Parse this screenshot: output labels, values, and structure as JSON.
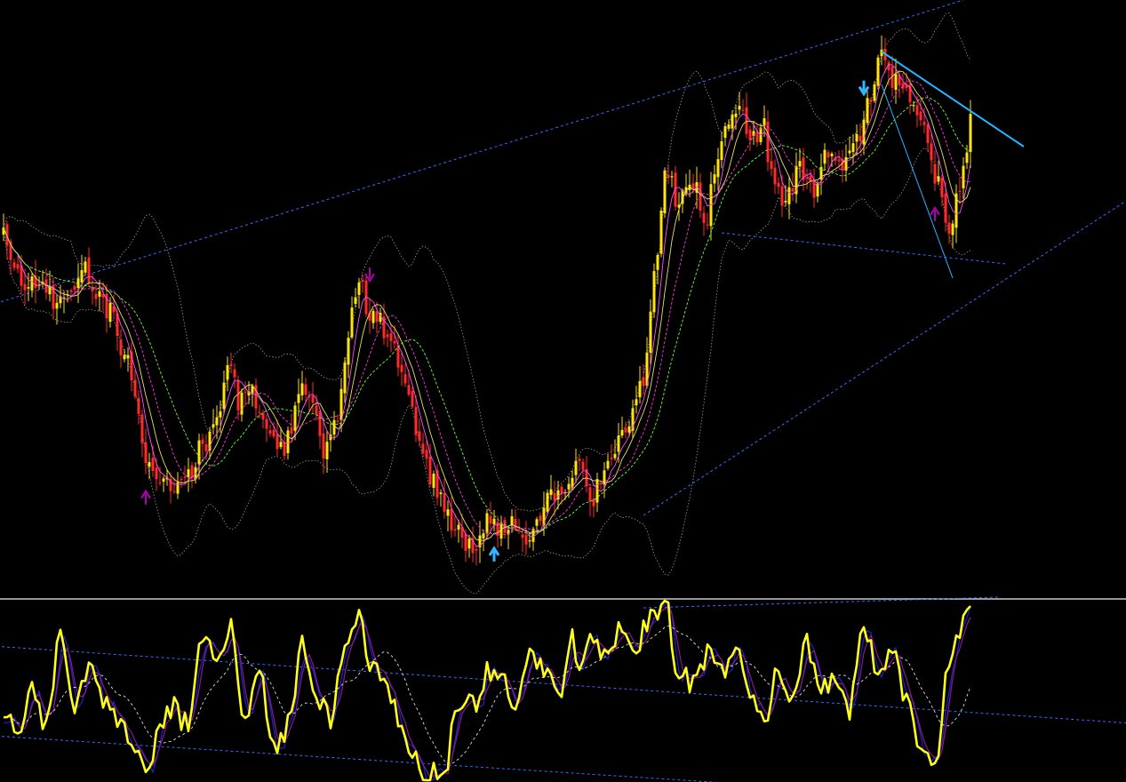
{
  "colors": {
    "background": "#000000",
    "bull_candle": "#FFE500",
    "bear_candle": "#FF2A2A",
    "bollinger_band": "#9A9A9A",
    "ma_fast": "#FF4FFF",
    "ma_mid": "#E8E06A",
    "ma_slow": "#6CFF3A",
    "ma_dash_magenta": "#FF3AD8",
    "channel_line": "#3A6BFF",
    "trendline": "#22B8FF",
    "signal_arrow_sell": "#B000B0",
    "signal_arrow_buy": "#B000B0",
    "signal_arrow_accent": "#33B5FF",
    "oscillator_main": "#FFFF1A",
    "oscillator_signal_blue": "#2222CC",
    "oscillator_signal_purple": "#8A1A8A",
    "oscillator_signal_dash": "#DDDDDD",
    "pane_separator": "#C8C8C8"
  },
  "icons": {
    "sell": "down-arrow-icon",
    "buy": "up-arrow-icon"
  },
  "chart_data": [
    {
      "type": "candlestick",
      "pane": "price",
      "grid": false,
      "legend": "none",
      "ylim": [
        0,
        665
      ],
      "price_waypoints": [
        [
          0,
          268
        ],
        [
          6,
          318
        ],
        [
          12,
          330
        ],
        [
          16,
          342
        ],
        [
          20,
          333
        ],
        [
          22,
          300
        ],
        [
          26,
          325
        ],
        [
          30,
          350
        ],
        [
          34,
          395
        ],
        [
          38,
          468
        ],
        [
          40,
          525
        ],
        [
          44,
          540
        ],
        [
          48,
          548
        ],
        [
          52,
          538
        ],
        [
          56,
          500
        ],
        [
          60,
          478
        ],
        [
          64,
          400
        ],
        [
          66,
          455
        ],
        [
          70,
          445
        ],
        [
          74,
          470
        ],
        [
          78,
          510
        ],
        [
          80,
          490
        ],
        [
          84,
          440
        ],
        [
          88,
          465
        ],
        [
          90,
          505
        ],
        [
          94,
          470
        ],
        [
          96,
          395
        ],
        [
          98,
          352
        ],
        [
          100,
          310
        ],
        [
          102,
          345
        ],
        [
          106,
          365
        ],
        [
          110,
          395
        ],
        [
          114,
          440
        ],
        [
          116,
          495
        ],
        [
          120,
          535
        ],
        [
          124,
          570
        ],
        [
          128,
          600
        ],
        [
          132,
          620
        ],
        [
          136,
          585
        ],
        [
          140,
          600
        ],
        [
          144,
          590
        ],
        [
          148,
          615
        ],
        [
          150,
          595
        ],
        [
          154,
          555
        ],
        [
          158,
          545
        ],
        [
          162,
          520
        ],
        [
          166,
          560
        ],
        [
          168,
          535
        ],
        [
          172,
          500
        ],
        [
          176,
          470
        ],
        [
          180,
          435
        ],
        [
          182,
          340
        ],
        [
          184,
          275
        ],
        [
          186,
          195
        ],
        [
          190,
          225
        ],
        [
          194,
          210
        ],
        [
          198,
          245
        ],
        [
          200,
          185
        ],
        [
          204,
          145
        ],
        [
          206,
          115
        ],
        [
          210,
          155
        ],
        [
          214,
          145
        ],
        [
          216,
          200
        ],
        [
          220,
          225
        ],
        [
          224,
          190
        ],
        [
          228,
          210
        ],
        [
          232,
          165
        ],
        [
          236,
          185
        ],
        [
          240,
          160
        ],
        [
          244,
          115
        ],
        [
          246,
          55
        ],
        [
          250,
          90
        ],
        [
          254,
          110
        ],
        [
          258,
          140
        ],
        [
          262,
          195
        ],
        [
          266,
          250
        ],
        [
          269,
          220
        ],
        [
          270,
          180
        ],
        [
          272,
          140
        ]
      ],
      "n_candles": 273,
      "moving_averages": [
        {
          "period": 5,
          "style": "solid",
          "color_key": "ma_fast"
        },
        {
          "period": 8,
          "style": "solid",
          "color_key": "ma_mid"
        },
        {
          "period": 13,
          "style": "dashed",
          "color_key": "ma_dash_magenta"
        },
        {
          "period": 21,
          "style": "dashed",
          "color_key": "ma_slow"
        }
      ],
      "bollinger_period": 20,
      "channels": [
        [
          [
            -5,
            345
          ],
          [
            270,
            0
          ]
        ],
        [
          [
            180,
            580
          ],
          [
            320,
            215
          ]
        ],
        [
          [
            202,
            262
          ],
          [
            282,
            297
          ]
        ]
      ],
      "trendlines": [
        [
          [
            247,
            58
          ],
          [
            287,
            165
          ],
          2
        ],
        [
          [
            247,
            95
          ],
          [
            267,
            313
          ],
          1
        ]
      ],
      "signals": [
        {
          "i": 40,
          "type": "buy"
        },
        {
          "i": 103,
          "type": "sell"
        },
        {
          "i": 138,
          "type": "buy",
          "accent": true
        },
        {
          "i": 242,
          "type": "sell",
          "accent": true
        },
        {
          "i": 262,
          "type": "buy"
        }
      ]
    },
    {
      "type": "line",
      "pane": "oscillator",
      "grid": false,
      "legend": "none",
      "ylim": [
        0,
        100
      ],
      "osc_waypoints": [
        [
          0,
          40
        ],
        [
          4,
          20
        ],
        [
          8,
          55
        ],
        [
          12,
          30
        ],
        [
          16,
          82
        ],
        [
          20,
          40
        ],
        [
          24,
          60
        ],
        [
          28,
          45
        ],
        [
          32,
          35
        ],
        [
          36,
          25
        ],
        [
          40,
          5
        ],
        [
          44,
          30
        ],
        [
          48,
          40
        ],
        [
          52,
          30
        ],
        [
          56,
          78
        ],
        [
          60,
          65
        ],
        [
          64,
          90
        ],
        [
          68,
          30
        ],
        [
          72,
          60
        ],
        [
          76,
          20
        ],
        [
          80,
          30
        ],
        [
          84,
          75
        ],
        [
          88,
          45
        ],
        [
          92,
          35
        ],
        [
          96,
          70
        ],
        [
          100,
          88
        ],
        [
          104,
          60
        ],
        [
          108,
          50
        ],
        [
          112,
          30
        ],
        [
          116,
          10
        ],
        [
          120,
          3
        ],
        [
          124,
          5
        ],
        [
          128,
          45
        ],
        [
          132,
          40
        ],
        [
          136,
          60
        ],
        [
          140,
          55
        ],
        [
          144,
          45
        ],
        [
          148,
          70
        ],
        [
          152,
          60
        ],
        [
          156,
          45
        ],
        [
          160,
          85
        ],
        [
          162,
          60
        ],
        [
          166,
          78
        ],
        [
          170,
          65
        ],
        [
          174,
          85
        ],
        [
          178,
          75
        ],
        [
          182,
          90
        ],
        [
          186,
          98
        ],
        [
          190,
          60
        ],
        [
          194,
          55
        ],
        [
          198,
          70
        ],
        [
          202,
          60
        ],
        [
          206,
          72
        ],
        [
          210,
          50
        ],
        [
          214,
          35
        ],
        [
          218,
          60
        ],
        [
          222,
          40
        ],
        [
          226,
          75
        ],
        [
          230,
          50
        ],
        [
          234,
          60
        ],
        [
          238,
          40
        ],
        [
          242,
          88
        ],
        [
          246,
          60
        ],
        [
          250,
          70
        ],
        [
          254,
          45
        ],
        [
          258,
          20
        ],
        [
          262,
          5
        ],
        [
          266,
          65
        ],
        [
          270,
          90
        ],
        [
          272,
          92
        ]
      ],
      "channels": [
        [
          [
            -5,
            75
          ],
          [
            330,
            30
          ]
        ],
        [
          [
            -5,
            25
          ],
          [
            270,
            -10
          ]
        ],
        [
          [
            180,
            96
          ],
          [
            280,
            102
          ]
        ]
      ]
    }
  ]
}
